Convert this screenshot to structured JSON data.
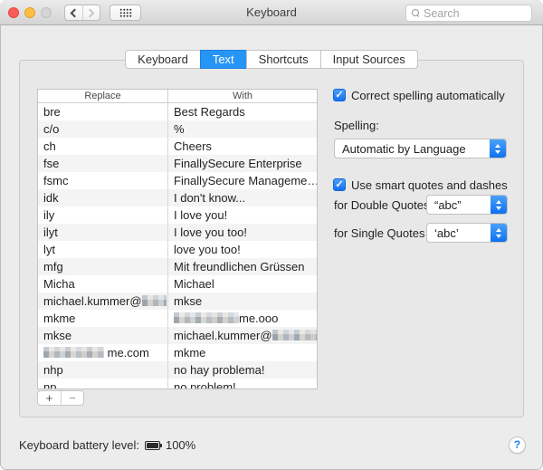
{
  "window": {
    "title": "Keyboard"
  },
  "toolbar": {
    "search_placeholder": "Search",
    "back_button": "back",
    "forward_button": "forward",
    "show_all_button": "show-all-grid"
  },
  "tabs": [
    {
      "label": "Keyboard",
      "active": false
    },
    {
      "label": "Text",
      "active": true
    },
    {
      "label": "Shortcuts",
      "active": false
    },
    {
      "label": "Input Sources",
      "active": false
    }
  ],
  "table": {
    "headers": [
      "Replace",
      "With"
    ],
    "rows": [
      {
        "replace": {
          "before": "bre",
          "redact": 0,
          "after": ""
        },
        "with": {
          "before": "Best Regards",
          "redact": 0,
          "after": ""
        }
      },
      {
        "replace": {
          "before": "c/o",
          "redact": 0,
          "after": ""
        },
        "with": {
          "before": "%",
          "redact": 0,
          "after": ""
        }
      },
      {
        "replace": {
          "before": "ch",
          "redact": 0,
          "after": ""
        },
        "with": {
          "before": "Cheers",
          "redact": 0,
          "after": ""
        }
      },
      {
        "replace": {
          "before": "fse",
          "redact": 0,
          "after": ""
        },
        "with": {
          "before": "FinallySecure Enterprise",
          "redact": 0,
          "after": ""
        }
      },
      {
        "replace": {
          "before": "fsmc",
          "redact": 0,
          "after": ""
        },
        "with": {
          "before": "FinallySecure Manageme…",
          "redact": 0,
          "after": ""
        }
      },
      {
        "replace": {
          "before": "idk",
          "redact": 0,
          "after": ""
        },
        "with": {
          "before": "I don't know...",
          "redact": 0,
          "after": ""
        }
      },
      {
        "replace": {
          "before": "ily",
          "redact": 0,
          "after": ""
        },
        "with": {
          "before": "I love you!",
          "redact": 0,
          "after": ""
        }
      },
      {
        "replace": {
          "before": "ilyt",
          "redact": 0,
          "after": ""
        },
        "with": {
          "before": "I love you too!",
          "redact": 0,
          "after": ""
        }
      },
      {
        "replace": {
          "before": "lyt",
          "redact": 0,
          "after": ""
        },
        "with": {
          "before": "love you too!",
          "redact": 0,
          "after": ""
        }
      },
      {
        "replace": {
          "before": "mfg",
          "redact": 0,
          "after": ""
        },
        "with": {
          "before": "Mit freundlichen Grüssen",
          "redact": 0,
          "after": ""
        }
      },
      {
        "replace": {
          "before": "Micha",
          "redact": 0,
          "after": ""
        },
        "with": {
          "before": "Michael",
          "redact": 0,
          "after": ""
        }
      },
      {
        "replace": {
          "before": "michael.kummer@",
          "redact": 27,
          "after": ""
        },
        "with": {
          "before": "mkse",
          "redact": 0,
          "after": ""
        }
      },
      {
        "replace": {
          "before": "mkme",
          "redact": 0,
          "after": ""
        },
        "with": {
          "before": "",
          "redact": 72,
          "after": "me.ooo"
        }
      },
      {
        "replace": {
          "before": "mkse",
          "redact": 0,
          "after": ""
        },
        "with": {
          "before": "michael.kummer@",
          "redact": 57,
          "after": ""
        }
      },
      {
        "replace": {
          "before": "",
          "redact": 67,
          "after": " me.com"
        },
        "with": {
          "before": "mkme",
          "redact": 0,
          "after": ""
        }
      },
      {
        "replace": {
          "before": "nhp",
          "redact": 0,
          "after": ""
        },
        "with": {
          "before": "no hay problema!",
          "redact": 0,
          "after": ""
        }
      },
      {
        "replace": {
          "before": "np",
          "redact": 0,
          "after": ""
        },
        "with": {
          "before": "no problem!",
          "redact": 0,
          "after": ""
        }
      }
    ]
  },
  "list_controls": {
    "add_label": "+",
    "remove_label": "−"
  },
  "options": {
    "correct_spelling": {
      "label": "Correct spelling automatically",
      "checked": true,
      "check_glyph": "✓"
    },
    "spelling_label": "Spelling:",
    "spelling_value": "Automatic by Language",
    "smart_quotes": {
      "label": "Use smart quotes and dashes",
      "checked": true,
      "check_glyph": "✓"
    },
    "double_quotes": {
      "label": "for Double Quotes",
      "value": "“abc”"
    },
    "single_quotes": {
      "label": "for Single Quotes",
      "value": "‘abc’"
    }
  },
  "footer": {
    "battery_label": "Keyboard battery level:",
    "battery_level": "100%",
    "help_label": "?"
  },
  "colors": {
    "accent_blue": "#2795f6",
    "control_gradient_top": "#4ca0f8",
    "control_gradient_bottom": "#0f6ff0",
    "window_background": "#ececec",
    "traffic_red": "#fc5b57",
    "traffic_yellow": "#fdbe41",
    "traffic_disabled": "#d5d5d5"
  }
}
